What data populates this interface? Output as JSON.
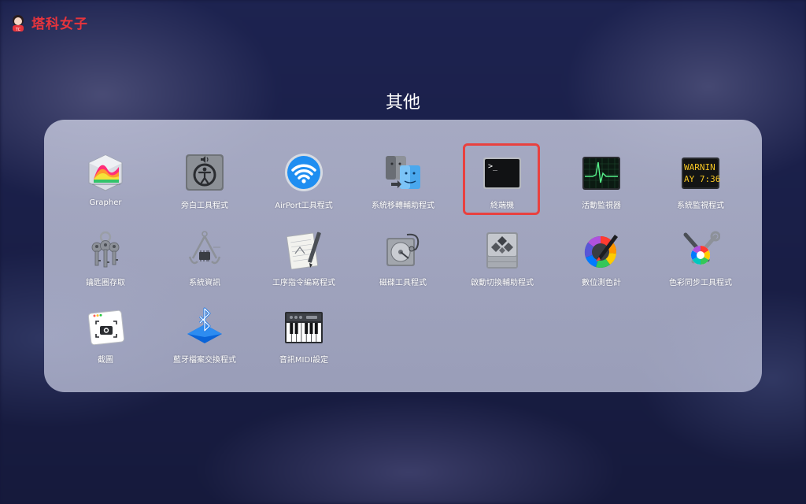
{
  "brand": {
    "name": "塔科女子",
    "accent": "#e8343c"
  },
  "folder": {
    "title": "其他"
  },
  "apps": [
    {
      "label": "Grapher",
      "icon": "grapher-icon"
    },
    {
      "label": "旁白工具程式",
      "icon": "voiceover-utility-icon"
    },
    {
      "label": "AirPort工具程式",
      "icon": "airport-utility-icon"
    },
    {
      "label": "系統移轉輔助程式",
      "icon": "migration-assistant-icon"
    },
    {
      "label": "終端機",
      "icon": "terminal-icon",
      "highlighted": true,
      "prompt": ">_"
    },
    {
      "label": "活動監視器",
      "icon": "activity-monitor-icon"
    },
    {
      "label": "系統監視程式",
      "icon": "console-icon",
      "screen_lines": [
        "WARNIN",
        "AY 7:36"
      ]
    },
    {
      "label": "鑰匙圈存取",
      "icon": "keychain-access-icon"
    },
    {
      "label": "系統資訊",
      "icon": "system-information-icon"
    },
    {
      "label": "工序指令編寫程式",
      "icon": "script-editor-icon"
    },
    {
      "label": "磁碟工具程式",
      "icon": "disk-utility-icon"
    },
    {
      "label": "啟動切換輔助程式",
      "icon": "boot-camp-assistant-icon"
    },
    {
      "label": "數位測色計",
      "icon": "digital-color-meter-icon"
    },
    {
      "label": "色彩同步工具程式",
      "icon": "colorsync-utility-icon"
    },
    {
      "label": "截圖",
      "icon": "screenshot-icon"
    },
    {
      "label": "藍牙檔案交換程式",
      "icon": "bluetooth-file-exchange-icon"
    },
    {
      "label": "音訊MIDI設定",
      "icon": "audio-midi-setup-icon"
    }
  ]
}
